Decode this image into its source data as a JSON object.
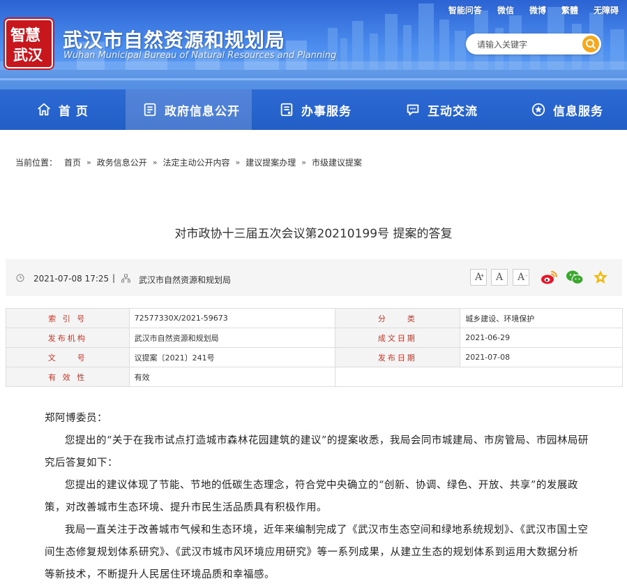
{
  "header": {
    "top_links": [
      "智能问答",
      "微信",
      "微博",
      "繁體",
      "无障碍"
    ],
    "seal_top": "智慧",
    "seal_bottom": "武汉",
    "org_name": "武汉市自然资源和规划局",
    "org_name_en": "Wuhan Municipal Bureau of Natural Resources and Planning",
    "search_placeholder": "请输入关键字",
    "nav": [
      {
        "label": "首 页",
        "icon": "home-icon"
      },
      {
        "label": "政府信息公开",
        "icon": "document-icon"
      },
      {
        "label": "办事服务",
        "icon": "service-icon"
      },
      {
        "label": "互动交流",
        "icon": "chat-icon"
      },
      {
        "label": "信息服务",
        "icon": "star-badge-icon"
      }
    ]
  },
  "breadcrumb": {
    "label": "当前位置：",
    "items": [
      "首页",
      "政务信息公开",
      "法定主动公开内容",
      "建议提案办理",
      "市级建议提案"
    ],
    "separator": "»"
  },
  "article": {
    "title": "对市政协十三届五次会议第20210199号 提案的答复",
    "date": "2021-07-08 17:25",
    "divider": "|",
    "source": "武汉市自然资源和规划局",
    "font_buttons": [
      "A",
      "A",
      "A"
    ],
    "font_button_sups": [
      "+",
      "",
      "-"
    ]
  },
  "info_table": {
    "rows": [
      {
        "k1": "索 引 号",
        "v1": "72577330X/2021-59673",
        "k2": "分　　类",
        "v2": "城乡建设、环境保护"
      },
      {
        "k1": "发布机构",
        "v1": "武汉市自然资源和规划局",
        "k2": "成文日期",
        "v2": "2021-06-29"
      },
      {
        "k1": "文　　号",
        "v1": "议提案〔2021〕241号",
        "k2": "发布日期",
        "v2": "2021-07-08"
      },
      {
        "k1": "有 效 性",
        "v1": "有效",
        "k2": "",
        "v2": ""
      }
    ]
  },
  "body": {
    "salutation": "郑阿博委员：",
    "paragraphs": [
      "您提出的“关于在我市试点打造城市森林花园建筑的建议”的提案收悉，我局会同市城建局、市房管局、市园林局研究后答复如下：",
      "您提出的建议体现了节能、节地的低碳生态理念，符合党中央确立的“创新、协调、绿色、开放、共享”的发展政策，对改善城市生态环境、提升市民生活品质具有积极作用。",
      "我局一直关注于改善城市气候和生态环境，近年来编制完成了《武汉市生态空间和绿地系统规划》、《武汉市国土空间生态修复规划体系研究》、《武汉市城市风环境应用研究》等一系列成果，从建立生态的规划体系到运用大数据分析等新技术，不断提升人民居住环境品质和幸福感。"
    ]
  },
  "colors": {
    "nav_bg": "#215ec6",
    "accent_red": "#c8161d",
    "search_button": "#f5a81d",
    "table_key": "#c0392b"
  }
}
